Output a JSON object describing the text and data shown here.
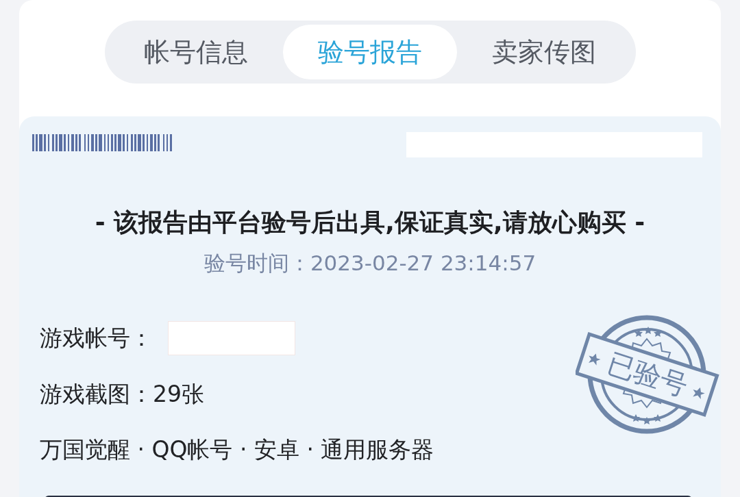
{
  "tabs": [
    {
      "label": "帐号信息",
      "selected": false
    },
    {
      "label": "验号报告",
      "selected": true
    },
    {
      "label": "卖家传图",
      "selected": false
    }
  ],
  "report": {
    "notice": "- 该报告由平台验号后出具,保证真实,请放心购买 -",
    "check_time": "验号时间：2023-02-27 23:14:57",
    "fields": [
      {
        "label": "游戏帐号：",
        "redacted": true
      },
      {
        "label": "游戏截图：",
        "value": "29张",
        "redacted": false
      }
    ],
    "tags": "万国觉醒 · QQ帐号 · 安卓 · 通用服务器",
    "stamp": "已验号"
  }
}
